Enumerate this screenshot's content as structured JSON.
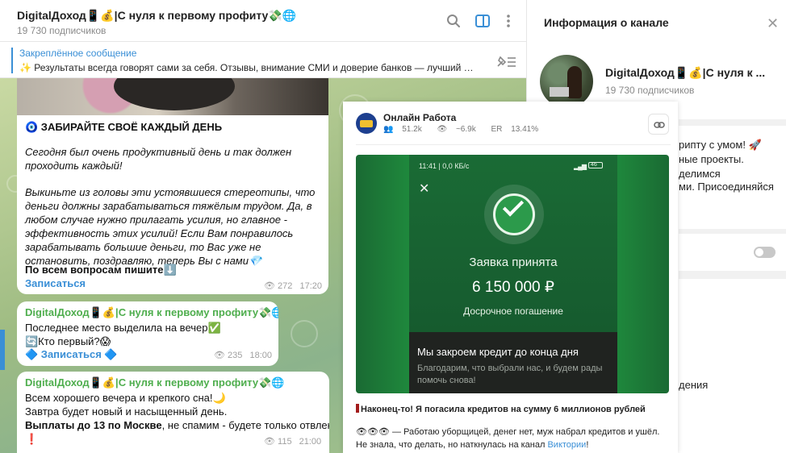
{
  "chat": {
    "title": "DigitalДоход📱💰|С нуля к первому профиту💸🌐",
    "subscribers": "19 730 подписчиков"
  },
  "pinned": {
    "title": "Закреплённое сообщение",
    "text": "✨ Результаты всегда говорят сами за себя. Отзывы, внимание СМИ и доверие банков — лучший п..."
  },
  "messages": {
    "m1": {
      "heading": "🧿 ЗАБИРАЙТЕ СВОЁ КАЖДЫЙ ДЕНЬ",
      "p1": "Сегодня был очень продуктивный день и так должен проходить каждый!",
      "p2": "Выкиньте из головы эти устоявшиеся стереотипы, что деньги должны зарабатываться тяжёлым трудом. Да, в любом случае нужно прилагать усилия, но главное - эффективность этих усилий! Если Вам понравилось зарабатывать большие деньги, то Вас уже не остановить, поздравляю, теперь Вы с нами💎",
      "contact": "По всем вопросам пишите⬇️",
      "link": "Записаться",
      "views": "272",
      "time": "17:20"
    },
    "m2": {
      "sender": "DigitalДоход📱💰|С нуля к первому профиту💸🌐",
      "line1": "Последнее место выделила на вечер✅",
      "line2": "🔄Кто первый?😱",
      "link": "🔷 Записаться 🔷",
      "views": "235",
      "time": "18:00"
    },
    "m3": {
      "sender": "DigitalДоход📱💰|С нуля к первому профиту💸🌐",
      "line1": "Всем хорошего вечера и крепкого сна!🌙",
      "line2": "Завтра будет новый и насыщенный день.",
      "line3_bold": "Выплаты до 13 по Москве",
      "line3_rest": ", не спамим - будете только отвлекать",
      "line4": "❗",
      "views": "115",
      "time": "21:00"
    }
  },
  "info": {
    "header": "Информация о канале",
    "name": "DigitalДоход📱💰|С нуля к ...",
    "subscribers": "19 730 подписчиков",
    "snip1": "рипту с умом! 🚀",
    "snip2": "ные проекты.",
    "snip3": "делимся",
    "snip4": "ми. Присоединяйся",
    "snip5": "дения"
  },
  "overlay": {
    "name": "Онлайн Работа",
    "subs": "51.2k",
    "views": "~6.9k",
    "er_label": "ER",
    "er": "13.41%",
    "phone": {
      "status": "11:41 | 0,0 КБ/с",
      "battery": "46",
      "title": "Заявка принята",
      "amount": "6 150 000 ₽",
      "subtitle": "Досрочное погашение",
      "card_title": "Мы закроем кредит до конца дня",
      "card_text": "Благодарим, что выбрали нас, и будем рады помочь снова!"
    },
    "bold_line": "Наконец-то! Я погасила кредитов на сумму 6 миллионов рублей",
    "body_text": "👁👁👁 — Работаю уборщицей, денег нет, муж набрал кредитов и ушёл. Не знала, что делать, но наткнулась на канал ",
    "body_link": "Виктории",
    "body_end": "!"
  },
  "icons": {
    "search": "search-icon",
    "columns": "sidebar-toggle-icon",
    "more": "more-vertical-icon",
    "pin": "pin-list-icon",
    "close": "close-icon",
    "eye": "eye-icon",
    "link": "link-icon"
  },
  "colors": {
    "accent": "#3a8fd6",
    "sender": "#4fae4e",
    "chat_bg": "#9fbc83"
  }
}
